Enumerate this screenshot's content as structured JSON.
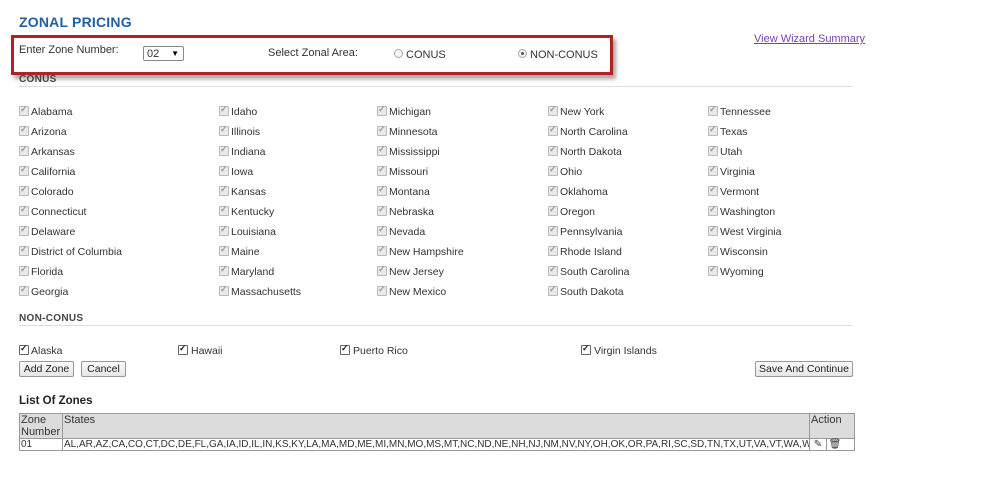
{
  "page": {
    "title": "ZONAL PRICING",
    "view_link": "View Wizard Summary"
  },
  "zone_bar": {
    "zone_label": "Enter Zone Number:",
    "zone_value": "02",
    "area_label": "Select Zonal Area:",
    "options": [
      {
        "label": "CONUS",
        "selected": false
      },
      {
        "label": "NON-CONUS",
        "selected": true
      }
    ]
  },
  "conus": {
    "heading": "CONUS",
    "columns": [
      [
        "Alabama",
        "Arizona",
        "Arkansas",
        "California",
        "Colorado",
        "Connecticut",
        "Delaware",
        "District of Columbia",
        "Florida",
        "Georgia"
      ],
      [
        "Idaho",
        "Illinois",
        "Indiana",
        "Iowa",
        "Kansas",
        "Kentucky",
        "Louisiana",
        "Maine",
        "Maryland",
        "Massachusetts"
      ],
      [
        "Michigan",
        "Minnesota",
        "Mississippi",
        "Missouri",
        "Montana",
        "Nebraska",
        "Nevada",
        "New Hampshire",
        "New Jersey",
        "New Mexico"
      ],
      [
        "New York",
        "North Carolina",
        "North Dakota",
        "Ohio",
        "Oklahoma",
        "Oregon",
        "Pennsylvania",
        "Rhode Island",
        "South Carolina",
        "South Dakota"
      ],
      [
        "Tennessee",
        "Texas",
        "Utah",
        "Virginia",
        "Vermont",
        "Washington",
        "West Virginia",
        "Wisconsin",
        "Wyoming"
      ]
    ]
  },
  "non_conus": {
    "heading": "NON-CONUS",
    "items": [
      "Alaska",
      "Hawaii",
      "Puerto Rico",
      "Virgin Islands"
    ]
  },
  "buttons": {
    "add_zone": "Add Zone",
    "cancel": "Cancel",
    "save_continue": "Save And Continue"
  },
  "zones_table": {
    "title": "List Of Zones",
    "headers": {
      "zone": "Zone Number",
      "states": "States",
      "action": "Action"
    },
    "rows": [
      {
        "zone": "01",
        "states": "AL,AR,AZ,CA,CO,CT,DC,DE,FL,GA,IA,ID,IL,IN,KS,KY,LA,MA,MD,ME,MI,MN,MO,MS,MT,NC,ND,NE,NH,NJ,NM,NV,NY,OH,OK,OR,PA,RI,SC,SD,TN,TX,UT,VA,VT,WA,WI,WV,WY"
      }
    ]
  }
}
